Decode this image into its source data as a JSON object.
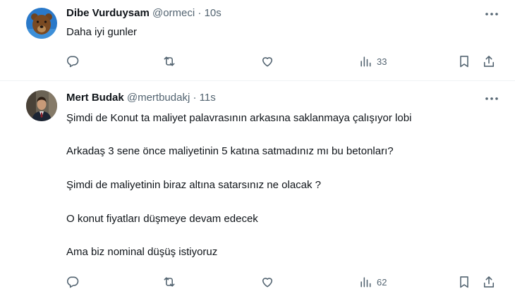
{
  "tweets": [
    {
      "display_name": "Dibe Vurduysam",
      "handle": "@ormeci",
      "separator": "·",
      "time": "10s",
      "body": [
        "Daha iyi gunler"
      ],
      "views": "33",
      "avatar_colors": {
        "bg": "#2a79c9",
        "fg": "#7a4a22"
      }
    },
    {
      "display_name": "Mert Budak",
      "handle": "@mertbudakj",
      "separator": "·",
      "time": "11s",
      "body": [
        "Şimdi de Konut ta maliyet palavrasının arkasına saklanmaya çalışıyor lobi",
        "Arkadaş 3 sene önce maliyetinin 5 katına satmadınız mı bu betonları?",
        "Şimdi de maliyetinin biraz altına satarsınız ne olacak ?",
        "O konut fiyatları düşmeye devam edecek",
        "Ama biz nominal düşüş istiyoruz"
      ],
      "views": "62",
      "avatar_colors": {
        "bg": "#6b6355",
        "fg": "#1b2433"
      }
    }
  ],
  "icons": [
    "more-icon",
    "reply-icon",
    "retweet-icon",
    "like-icon",
    "views-icon",
    "bookmark-icon",
    "share-icon"
  ],
  "colors": {
    "text": "#0f1419",
    "secondary": "#536471",
    "divider": "#eff3f4"
  }
}
